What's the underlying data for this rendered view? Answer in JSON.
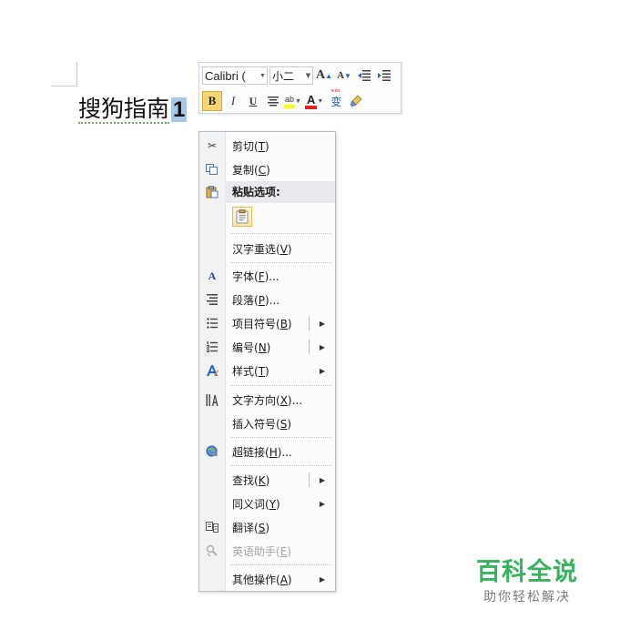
{
  "document": {
    "body_text": "搜狗指南",
    "selected_text": "1"
  },
  "mini_toolbar": {
    "font_name": "Calibri (",
    "font_size": "小二",
    "grow_font_label": "A",
    "shrink_font_label": "A",
    "bold_label": "B",
    "italic_label": "I",
    "underline_label": "U",
    "highlight_label": "ab",
    "font_color_label": "A",
    "phonetic_label": "变",
    "phonetic_small": "wén",
    "colors": {
      "highlight": "#ffff00",
      "font_color": "#e12020",
      "bold_active": "#f7d574"
    }
  },
  "context_menu": {
    "items": [
      {
        "icon": "scissors-icon",
        "text": "剪切(",
        "key": "T",
        "close": ")"
      },
      {
        "icon": "copy-icon",
        "text": "复制(",
        "key": "C",
        "close": ")"
      },
      {
        "header": "粘贴选项:"
      },
      {
        "icon": "clipboard-paste-icon"
      },
      {
        "text": "汉字重选(",
        "key": "V",
        "close": ")"
      },
      {
        "icon": "font-icon",
        "text": "字体(",
        "key": "F",
        "close": ")..."
      },
      {
        "icon": "paragraph-icon",
        "text": "段落(",
        "key": "P",
        "close": ")..."
      },
      {
        "icon": "bullets-icon",
        "text": "项目符号(",
        "key": "B",
        "close": ")"
      },
      {
        "icon": "numbering-icon",
        "text": "编号(",
        "key": "N",
        "close": ")"
      },
      {
        "icon": "styles-icon",
        "text": "样式(",
        "key": "T",
        "close": ")"
      },
      {
        "icon": "text-direction-icon",
        "text": "文字方向(",
        "key": "X",
        "close": ")..."
      },
      {
        "text": "插入符号(",
        "key": "S",
        "close": ")"
      },
      {
        "icon": "hyperlink-globe-icon",
        "text": "超链接(",
        "key": "H",
        "close": ")..."
      },
      {
        "text": "查找(",
        "key": "K",
        "close": ")"
      },
      {
        "text": "同义词(",
        "key": "Y",
        "close": ")"
      },
      {
        "icon": "translate-icon",
        "text": "翻译(",
        "key": "S",
        "close": ")"
      },
      {
        "icon": "english-assistant-icon",
        "text": "英语助手(",
        "key": "E",
        "close": ")"
      },
      {
        "text": "其他操作(",
        "key": "A",
        "close": ")"
      }
    ]
  },
  "watermark": {
    "title": "百科全说",
    "subtitle": "助你轻松解决",
    "color": "#36b35c"
  }
}
